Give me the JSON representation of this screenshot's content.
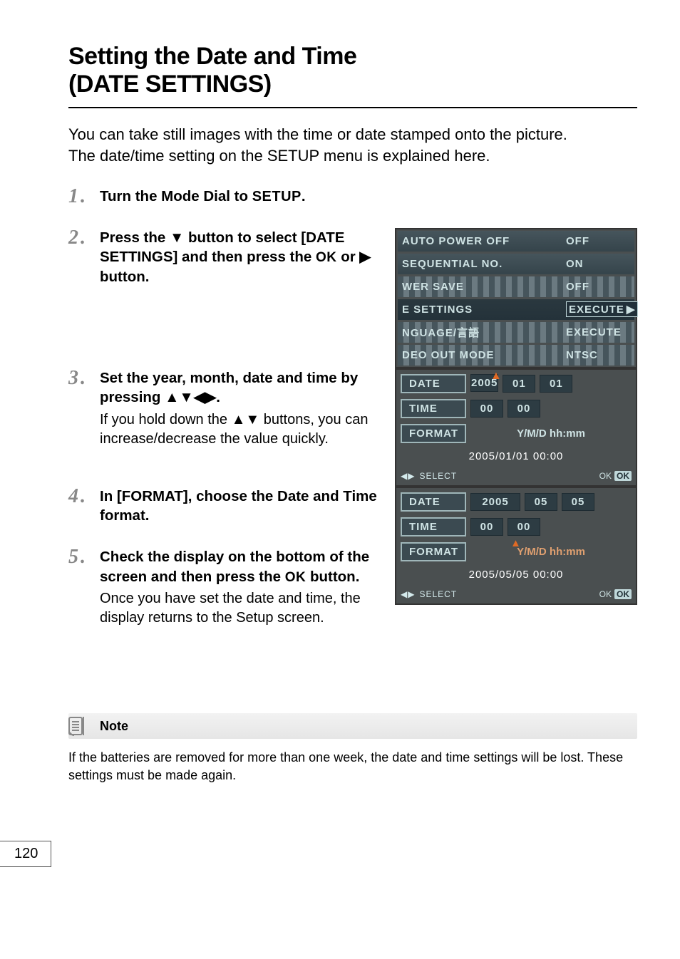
{
  "title_line1": "Setting the Date and Time",
  "title_line2": "(DATE SETTINGS)",
  "intro1": "You can take still images with the time or date stamped onto the picture.",
  "intro2": "The date/time setting on the SETUP menu is explained here.",
  "steps": {
    "s1": {
      "num": "1",
      "bold_a": "Turn the Mode Dial to ",
      "setup": "SETUP",
      "bold_b": "."
    },
    "s2": {
      "num": "2",
      "bold": "Press the ▼ button to select [DATE SETTINGS] and then press the ",
      "ok": "OK",
      "bold_b": " or ▶ button."
    },
    "s3": {
      "num": "3",
      "bold": "Set the year, month, date and time by pressing ▲▼◀▶.",
      "sub": "If you hold down the ▲▼ buttons, you can increase/decrease the value quickly."
    },
    "s4": {
      "num": "4",
      "bold": "In [FORMAT], choose the Date and Time format."
    },
    "s5": {
      "num": "5",
      "bold_a": "Check the display on the bottom of the screen and then press the ",
      "ok": "OK",
      "bold_b": " button.",
      "sub": "Once you have set the date and time, the display returns to the Setup screen."
    }
  },
  "setup_menu": {
    "rows": [
      {
        "label": "AUTO POWER OFF",
        "value": "OFF"
      },
      {
        "label": "SEQUENTIAL NO.",
        "value": "ON"
      },
      {
        "label": "WER SAVE",
        "value": "OFF",
        "glitch": true
      },
      {
        "label": "E SETTINGS",
        "value": "EXECUTE",
        "selected": true,
        "glitch": true
      },
      {
        "label": "NGUAGE/言語",
        "value": "EXECUTE",
        "glitch": true
      },
      {
        "label": "DEO OUT MODE",
        "value": "NTSC",
        "glitch": true
      }
    ]
  },
  "date_screen1": {
    "date": {
      "label": "DATE",
      "y": "2005",
      "m": "01",
      "d": "01",
      "cursor": "y"
    },
    "time": {
      "label": "TIME",
      "h": "00",
      "mi": "00"
    },
    "format": {
      "label": "FORMAT",
      "value": "Y/M/D hh:mm"
    },
    "combined": "2005/01/01 00:00",
    "select": "SELECT",
    "ok": "OK"
  },
  "date_screen2": {
    "date": {
      "label": "DATE",
      "y": "2005",
      "m": "05",
      "d": "05",
      "cursor": "none"
    },
    "time": {
      "label": "TIME",
      "h": "00",
      "mi": "00"
    },
    "format": {
      "label": "FORMAT",
      "value": "Y/M/D hh:mm",
      "cursor": true
    },
    "combined": "2005/05/05 00:00",
    "select": "SELECT",
    "ok": "OK"
  },
  "note": {
    "title": "Note",
    "body": "If the batteries are removed for more than one week, the date and time settings will be lost. These settings must be made again."
  },
  "page_number": "120"
}
